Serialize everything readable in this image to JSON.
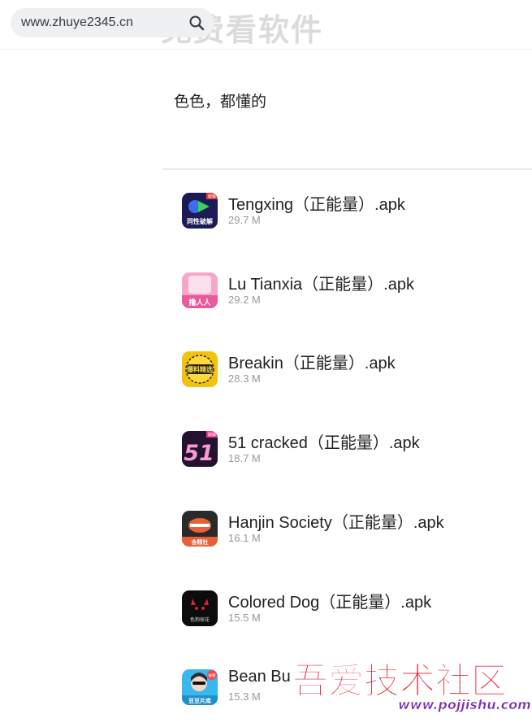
{
  "header": {
    "background_title": "免费看软件",
    "search": {
      "url_text": "www.zhuye2345.cn",
      "icon": "search-icon"
    }
  },
  "subtitle": "色色，都懂的",
  "files": [
    {
      "name": "Tengxing（正能量）.apk",
      "size": "29.7 M",
      "icon_label": "同性破解",
      "badge": "破解"
    },
    {
      "name": "Lu Tianxia（正能量）.apk",
      "size": "29.2 M",
      "icon_label": "撸人人"
    },
    {
      "name": "Breakin（正能量）.apk",
      "size": "28.3 M",
      "icon_label": "爆料精选"
    },
    {
      "name": "51 cracked（正能量）.apk",
      "size": "18.7 M",
      "icon_label": "51",
      "badge": "破解"
    },
    {
      "name": "Hanjin Society（正能量）.apk",
      "size": "16.1 M",
      "icon_label": "含精社"
    },
    {
      "name": "Colored Dog（正能量）.apk",
      "size": "15.5 M",
      "icon_label": "色狗探花"
    },
    {
      "name": "Bean Bu",
      "size": "15.3 M",
      "icon_label": "豆豆片库",
      "badge": "破解"
    }
  ],
  "watermark": {
    "text": "吾爱技术社区",
    "url": "www.pojjishu.com"
  },
  "colors": {
    "text": "#222222",
    "muted": "#999999",
    "search_bg": "#eef0f2",
    "watermark_red": "#e0102a",
    "watermark_purple": "#7b2fb3"
  }
}
